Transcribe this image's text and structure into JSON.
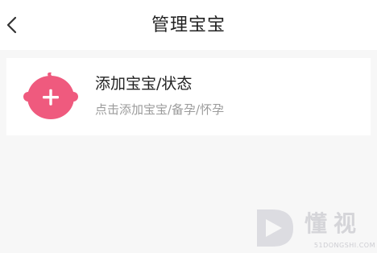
{
  "header": {
    "title": "管理宝宝",
    "back_icon": "chevron-left-icon"
  },
  "add_baby_card": {
    "title": "添加宝宝/状态",
    "subtitle": "点击添加宝宝/备孕/怀孕",
    "icon": "plus-icon",
    "accent_color": "#ef5a7e"
  },
  "watermark": {
    "text": "懂视",
    "domain": "51DONGSHI.COM"
  }
}
